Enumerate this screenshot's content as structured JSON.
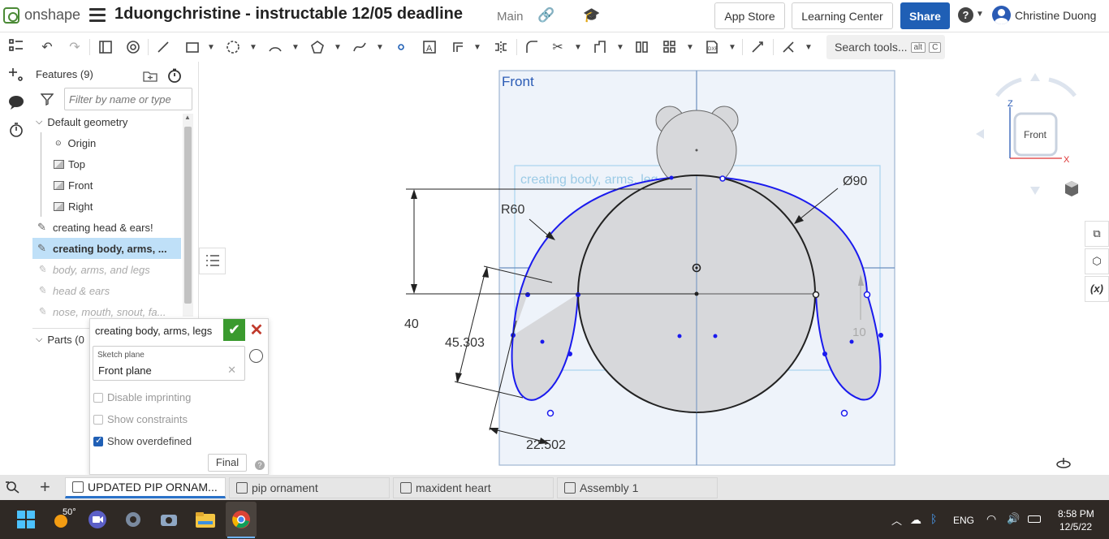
{
  "header": {
    "brand": "onshape",
    "doc_title": "1duongchristine - instructable 12/05 deadline",
    "doc_sub": "Main",
    "app_store": "App Store",
    "learning_center": "Learning Center",
    "share": "Share",
    "help": "?",
    "user": "Christine Duong"
  },
  "toolbar": {
    "search_tools": "Search tools...",
    "search_kbd1": "alt",
    "search_kbd2": "C"
  },
  "features": {
    "title": "Features (9)",
    "filter_placeholder": "Filter by name or type",
    "default_geometry": "Default geometry",
    "origin": "Origin",
    "top": "Top",
    "front": "Front",
    "right": "Right",
    "items": [
      "creating head & ears!",
      "creating body, arms, ...",
      "body, arms, and legs",
      "head & ears",
      "nose, mouth, snout, fa..."
    ],
    "parts": "Parts (0"
  },
  "sketch_dialog": {
    "name": "creating body, arms, legs",
    "plane_label": "Sketch plane",
    "plane_value": "Front plane",
    "disable_imprinting": "Disable imprinting",
    "show_constraints": "Show constraints",
    "show_overdefined": "Show overdefined",
    "final": "Final"
  },
  "viewport": {
    "plane_label": "Front",
    "ghost_label": "creating body, arms, leg",
    "dim_r60": "R60",
    "dim_d90": "Ø90",
    "dim_40": "40",
    "dim_45": "45.303",
    "dim_10": "10",
    "dim_22": "22.502",
    "viewcube": "Front",
    "axis_z": "Z",
    "axis_x": "X"
  },
  "tabs": [
    "UPDATED PIP ORNAM...",
    "pip ornament",
    "maxident heart",
    "Assembly 1"
  ],
  "taskbar": {
    "weather": "50°",
    "lang": "ENG",
    "time": "8:58 PM",
    "date": "12/5/22"
  },
  "colors": {
    "brand_green": "#4b8a36",
    "share_blue": "#1f5fb5",
    "sketch_blue": "#1a1aee",
    "selected_row": "#bfe0f8"
  }
}
